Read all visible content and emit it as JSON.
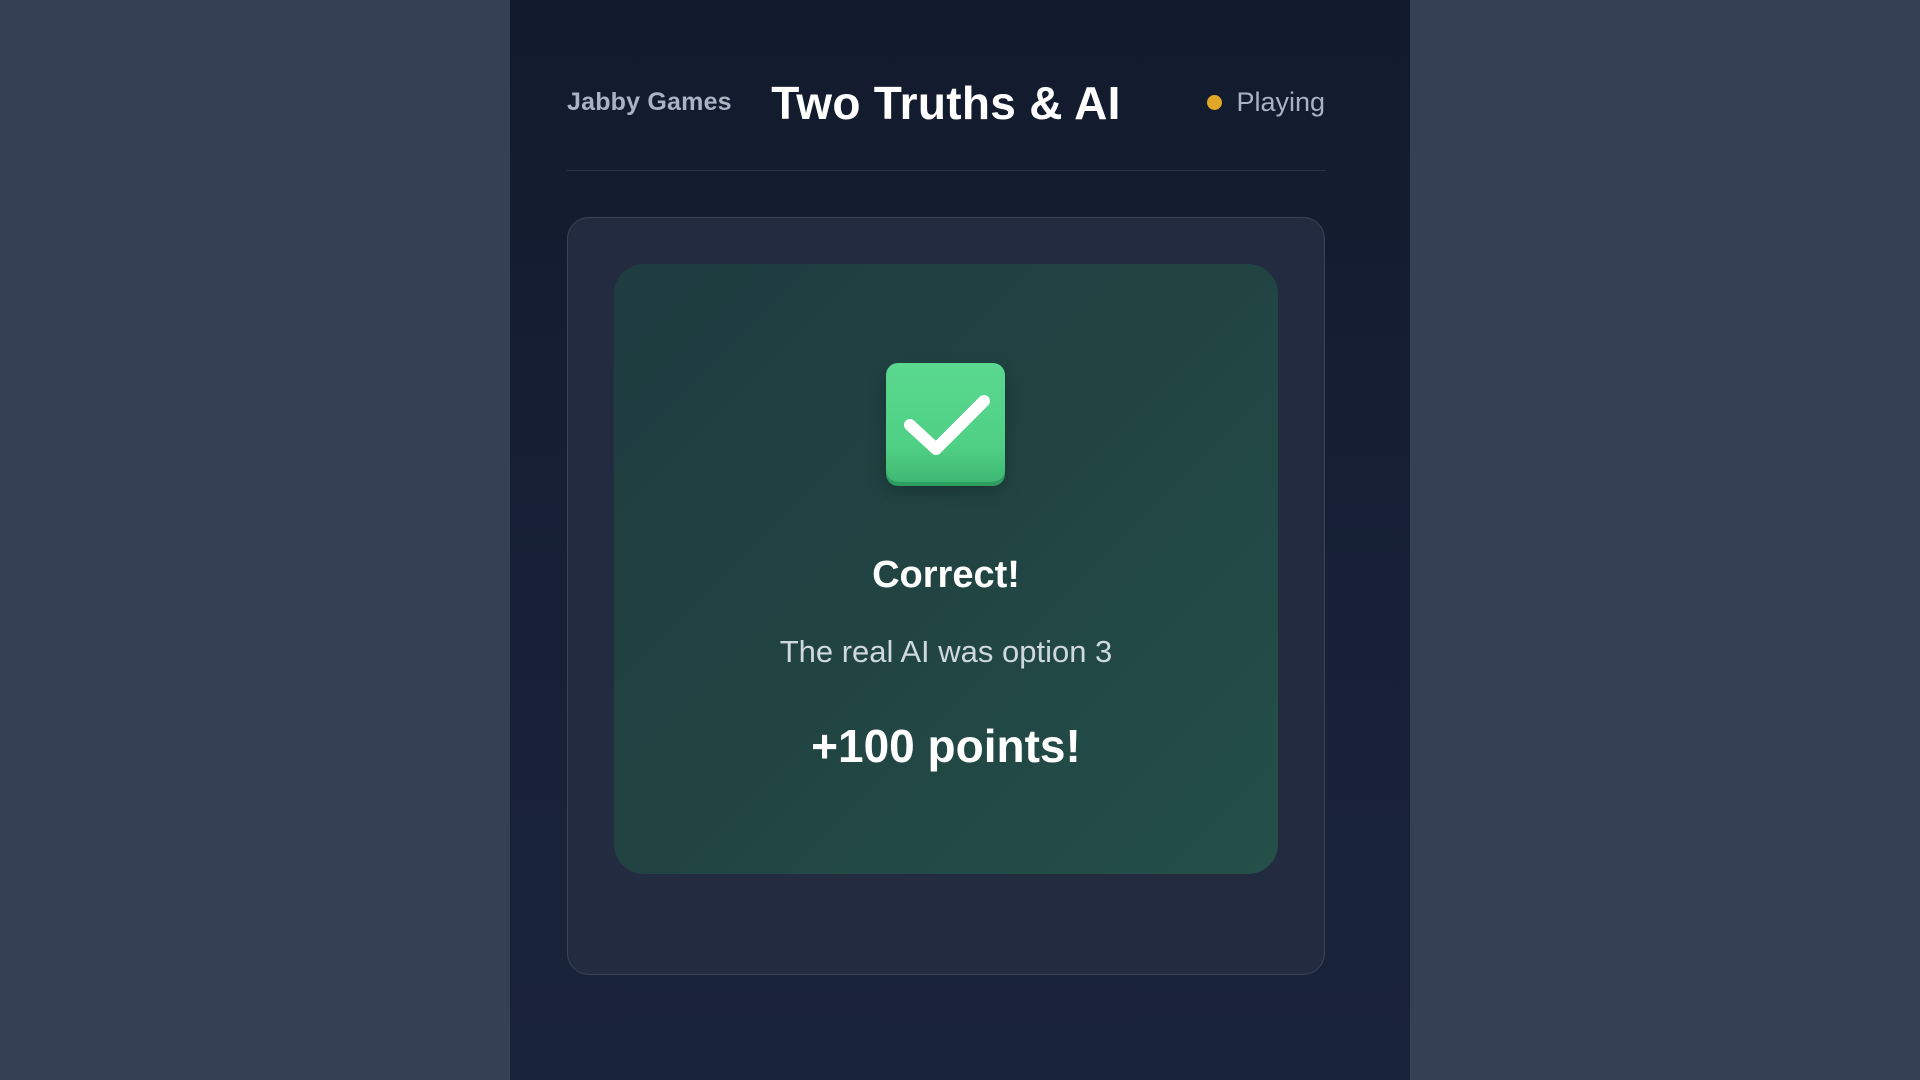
{
  "header": {
    "brand": "Jabby Games",
    "title": "Two Truths & AI",
    "status": {
      "label": "Playing",
      "dot_color": "#e0a826"
    }
  },
  "result": {
    "icon": "check-mark-icon",
    "icon_color": "#4fd085",
    "title": "Correct!",
    "message": "The real AI was option 3",
    "points": "+100 points!"
  },
  "colors": {
    "page_background": "#344054",
    "stage_background": "#121a2d",
    "card_background": "#232b40",
    "panel_background": "#214543"
  }
}
